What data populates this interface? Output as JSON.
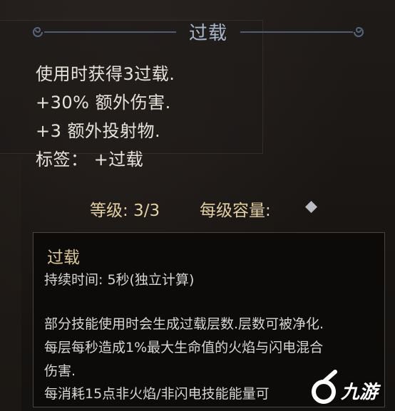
{
  "tooltip": {
    "title": "过载",
    "lines": [
      "使用时获得3过载.",
      "+30% 额外伤害.",
      "+3 额外投射物.",
      "标签： +过载"
    ],
    "level": "等级: 3/3",
    "capacity_label": "每级容量:",
    "capacity_icon": "diamond-icon"
  },
  "detail": {
    "title": "过载",
    "duration": "持续时间: 5秒(独立计算)",
    "desc": [
      "部分技能使用时会生成过载层数.层数可被净化.",
      "每层每秒造成1%最大生命值的火焰与闪电混合",
      "伤害.",
      "每消耗15点非火焰/非闪电技能能量可"
    ]
  },
  "watermark": {
    "text": "九游"
  },
  "colors": {
    "title": "#a9b6cc",
    "stats": "#e2cfa4",
    "detail_title": "#dcc79a",
    "body": "#e7e3dc"
  }
}
